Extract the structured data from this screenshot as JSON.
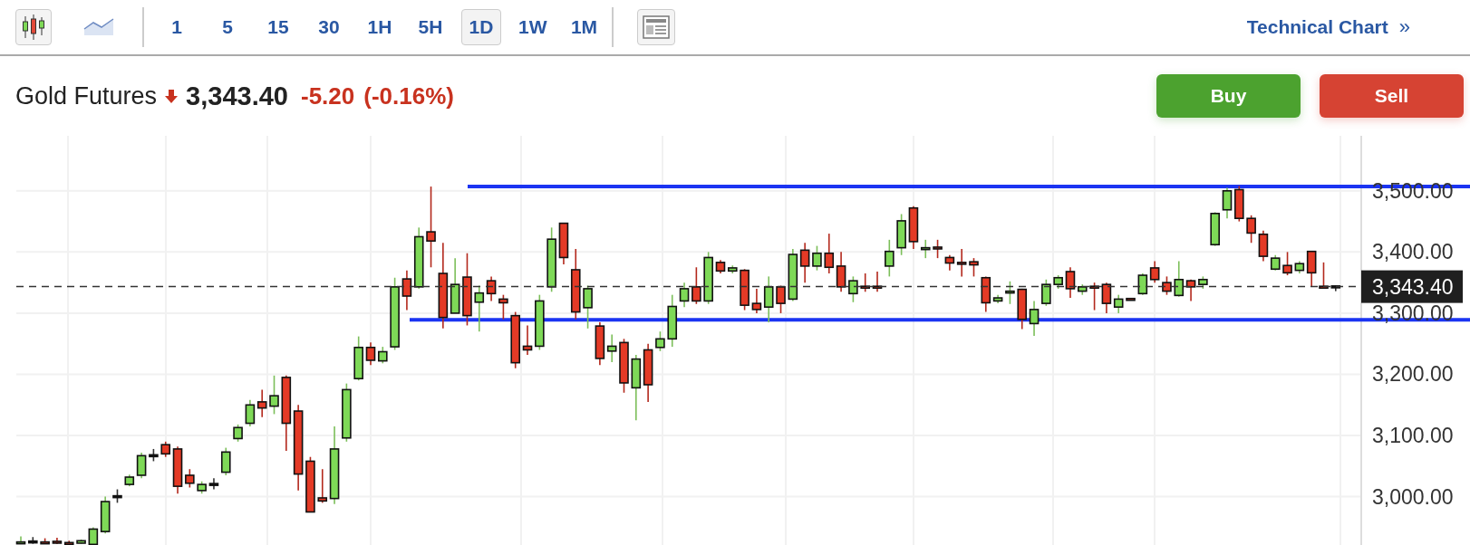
{
  "toolbar": {
    "chart_types": [
      {
        "kind": "candles",
        "selected": true
      },
      {
        "kind": "area",
        "selected": false
      }
    ],
    "intervals": [
      {
        "label": "1",
        "selected": false
      },
      {
        "label": "5",
        "selected": false
      },
      {
        "label": "15",
        "selected": false
      },
      {
        "label": "30",
        "selected": false
      },
      {
        "label": "1H",
        "selected": false
      },
      {
        "label": "5H",
        "selected": false
      },
      {
        "label": "1D",
        "selected": true
      },
      {
        "label": "1W",
        "selected": false
      },
      {
        "label": "1M",
        "selected": false
      }
    ],
    "link": {
      "label": "Technical Chart",
      "icon": "»"
    }
  },
  "quote": {
    "name": "Gold Futures",
    "falling": true,
    "price": "3,343.40",
    "change": "-5.20",
    "change_percent": "(-0.16%)"
  },
  "actions": [
    {
      "label": "Buy",
      "kind": "buy"
    },
    {
      "label": "Sell",
      "kind": "sell"
    }
  ],
  "chart": {
    "last_price_label": "3,343.40",
    "chart_data": {
      "type": "candlestick",
      "ylim": [
        2921,
        3590
      ],
      "grid": true,
      "categories": [
        null,
        null,
        null,
        null,
        null,
        null,
        null,
        null,
        null,
        null,
        null,
        null,
        null,
        null,
        null,
        null,
        null,
        null,
        null,
        null,
        null,
        null,
        null,
        null,
        null,
        null,
        null,
        null,
        null,
        null,
        null,
        null,
        null,
        null,
        null,
        null,
        null,
        null,
        null,
        null,
        null,
        null,
        null,
        null,
        null,
        null,
        null,
        null,
        null,
        null,
        null,
        null,
        null,
        null,
        null,
        null,
        null,
        null,
        null,
        null,
        null,
        null,
        null,
        null,
        null,
        null,
        null,
        null,
        null,
        null,
        null,
        null,
        null,
        null,
        null,
        null,
        null,
        null,
        null,
        null,
        null,
        null,
        null,
        null,
        null,
        null,
        null,
        null,
        null,
        null,
        null,
        null,
        null,
        null,
        null,
        null,
        null,
        null,
        null,
        null,
        null,
        null,
        null,
        null,
        null,
        null,
        null,
        null,
        null,
        null
      ],
      "yticks": [
        {
          "value": 3000,
          "label": "3,000.00"
        },
        {
          "value": 3100,
          "label": "3,100.00"
        },
        {
          "value": 3200,
          "label": "3,200.00"
        },
        {
          "value": 3300,
          "label": "3,300.00"
        },
        {
          "value": 3400,
          "label": "3,400.00"
        },
        {
          "value": 3500,
          "label": "3,500.00"
        }
      ],
      "ohlc": [
        [
          2925,
          2935,
          2923,
          2926
        ],
        [
          2926,
          2934,
          2923,
          2926
        ],
        [
          2926,
          2932,
          2923,
          2924
        ],
        [
          2927,
          2933,
          2923,
          2925
        ],
        [
          2925,
          2928,
          2923,
          2924
        ],
        [
          2924,
          2930,
          2923,
          2928
        ],
        [
          2922,
          2950,
          2920,
          2947
        ],
        [
          2943,
          3000,
          2940,
          2992
        ],
        [
          3000,
          3012,
          2990,
          3000
        ],
        [
          3020,
          3036,
          3017,
          3032
        ],
        [
          3035,
          3072,
          3030,
          3067
        ],
        [
          3067,
          3078,
          3058,
          3067
        ],
        [
          3085,
          3090,
          3065,
          3070
        ],
        [
          3078,
          3082,
          3005,
          3017
        ],
        [
          3035,
          3045,
          3015,
          3022
        ],
        [
          3010,
          3025,
          3005,
          3020
        ],
        [
          3020,
          3030,
          3012,
          3020
        ],
        [
          3040,
          3080,
          3035,
          3073
        ],
        [
          3095,
          3118,
          3090,
          3113
        ],
        [
          3120,
          3158,
          3115,
          3150
        ],
        [
          3155,
          3175,
          3130,
          3145
        ],
        [
          3148,
          3198,
          3135,
          3165
        ],
        [
          3195,
          3198,
          3075,
          3120
        ],
        [
          3140,
          3150,
          3010,
          3037
        ],
        [
          3058,
          3065,
          2975,
          2975
        ],
        [
          2998,
          3045,
          2990,
          2993
        ],
        [
          2997,
          3115,
          2988,
          3078
        ],
        [
          3096,
          3185,
          3090,
          3175
        ],
        [
          3193,
          3262,
          3190,
          3244
        ],
        [
          3244,
          3252,
          3215,
          3223
        ],
        [
          3222,
          3245,
          3218,
          3237
        ],
        [
          3245,
          3358,
          3240,
          3343
        ],
        [
          3356,
          3370,
          3305,
          3328
        ],
        [
          3343,
          3440,
          3340,
          3425
        ],
        [
          3433,
          3507,
          3375,
          3418
        ],
        [
          3365,
          3415,
          3275,
          3293
        ],
        [
          3300,
          3390,
          3300,
          3347
        ],
        [
          3359,
          3398,
          3280,
          3296
        ],
        [
          3318,
          3345,
          3270,
          3333
        ],
        [
          3353,
          3360,
          3320,
          3332
        ],
        [
          3323,
          3330,
          3290,
          3317
        ],
        [
          3296,
          3302,
          3210,
          3219
        ],
        [
          3246,
          3280,
          3232,
          3240
        ],
        [
          3246,
          3330,
          3240,
          3320
        ],
        [
          3343,
          3440,
          3335,
          3421
        ],
        [
          3447,
          3447,
          3380,
          3391
        ],
        [
          3371,
          3405,
          3290,
          3302
        ],
        [
          3309,
          3345,
          3275,
          3340
        ],
        [
          3279,
          3285,
          3215,
          3226
        ],
        [
          3238,
          3265,
          3220,
          3246
        ],
        [
          3252,
          3258,
          3170,
          3186
        ],
        [
          3178,
          3232,
          3125,
          3225
        ],
        [
          3240,
          3250,
          3155,
          3183
        ],
        [
          3244,
          3270,
          3238,
          3258
        ],
        [
          3258,
          3330,
          3245,
          3311
        ],
        [
          3320,
          3350,
          3310,
          3340
        ],
        [
          3343,
          3375,
          3315,
          3320
        ],
        [
          3320,
          3400,
          3315,
          3391
        ],
        [
          3383,
          3387,
          3365,
          3369
        ],
        [
          3369,
          3378,
          3365,
          3374
        ],
        [
          3370,
          3372,
          3305,
          3313
        ],
        [
          3316,
          3340,
          3300,
          3306
        ],
        [
          3310,
          3360,
          3285,
          3343
        ],
        [
          3343,
          3345,
          3300,
          3316
        ],
        [
          3323,
          3405,
          3320,
          3396
        ],
        [
          3403,
          3415,
          3350,
          3377
        ],
        [
          3377,
          3410,
          3370,
          3398
        ],
        [
          3398,
          3430,
          3365,
          3375
        ],
        [
          3377,
          3400,
          3335,
          3343
        ],
        [
          3332,
          3360,
          3318,
          3353
        ],
        [
          3344,
          3365,
          3335,
          3343
        ],
        [
          3344,
          3368,
          3335,
          3343
        ],
        [
          3377,
          3420,
          3360,
          3401
        ],
        [
          3407,
          3462,
          3395,
          3451
        ],
        [
          3472,
          3475,
          3405,
          3417
        ],
        [
          3406,
          3420,
          3390,
          3407
        ],
        [
          3408,
          3420,
          3390,
          3406
        ],
        [
          3391,
          3395,
          3370,
          3382
        ],
        [
          3383,
          3405,
          3360,
          3382
        ],
        [
          3384,
          3390,
          3360,
          3379
        ],
        [
          3358,
          3360,
          3302,
          3317
        ],
        [
          3320,
          3330,
          3316,
          3325
        ],
        [
          3335,
          3352,
          3315,
          3336
        ],
        [
          3339,
          3340,
          3274,
          3290
        ],
        [
          3283,
          3320,
          3263,
          3306
        ],
        [
          3316,
          3355,
          3312,
          3347
        ],
        [
          3347,
          3362,
          3340,
          3358
        ],
        [
          3368,
          3375,
          3325,
          3340
        ],
        [
          3336,
          3347,
          3330,
          3343
        ],
        [
          3344,
          3350,
          3305,
          3343
        ],
        [
          3347,
          3350,
          3300,
          3316
        ],
        [
          3310,
          3330,
          3300,
          3323
        ],
        [
          3324,
          3325,
          3322,
          3323
        ],
        [
          3332,
          3365,
          3330,
          3362
        ],
        [
          3374,
          3385,
          3350,
          3355
        ],
        [
          3350,
          3360,
          3330,
          3336
        ],
        [
          3329,
          3385,
          3327,
          3355
        ],
        [
          3353,
          3355,
          3320,
          3343
        ],
        [
          3347,
          3360,
          3340,
          3355
        ],
        [
          3412,
          3465,
          3410,
          3463
        ],
        [
          3469,
          3505,
          3455,
          3500
        ],
        [
          3502,
          3508,
          3450,
          3455
        ],
        [
          3455,
          3460,
          3415,
          3431
        ],
        [
          3429,
          3435,
          3385,
          3393
        ],
        [
          3372,
          3395,
          3370,
          3390
        ],
        [
          3378,
          3400,
          3362,
          3366
        ],
        [
          3370,
          3385,
          3365,
          3381
        ],
        [
          3401,
          3401,
          3343,
          3366
        ],
        [
          3344,
          3383,
          3342,
          3343
        ],
        [
          3343,
          3345,
          3336,
          3343
        ]
      ],
      "ref_lines": [
        {
          "axis": "y",
          "value": 3343.4,
          "color": "#333333"
        },
        {
          "axis": "y",
          "value": 3507,
          "color": "#1b34f2"
        },
        {
          "axis": "y",
          "value": 3289,
          "color": "#1b34f2"
        }
      ]
    }
  }
}
